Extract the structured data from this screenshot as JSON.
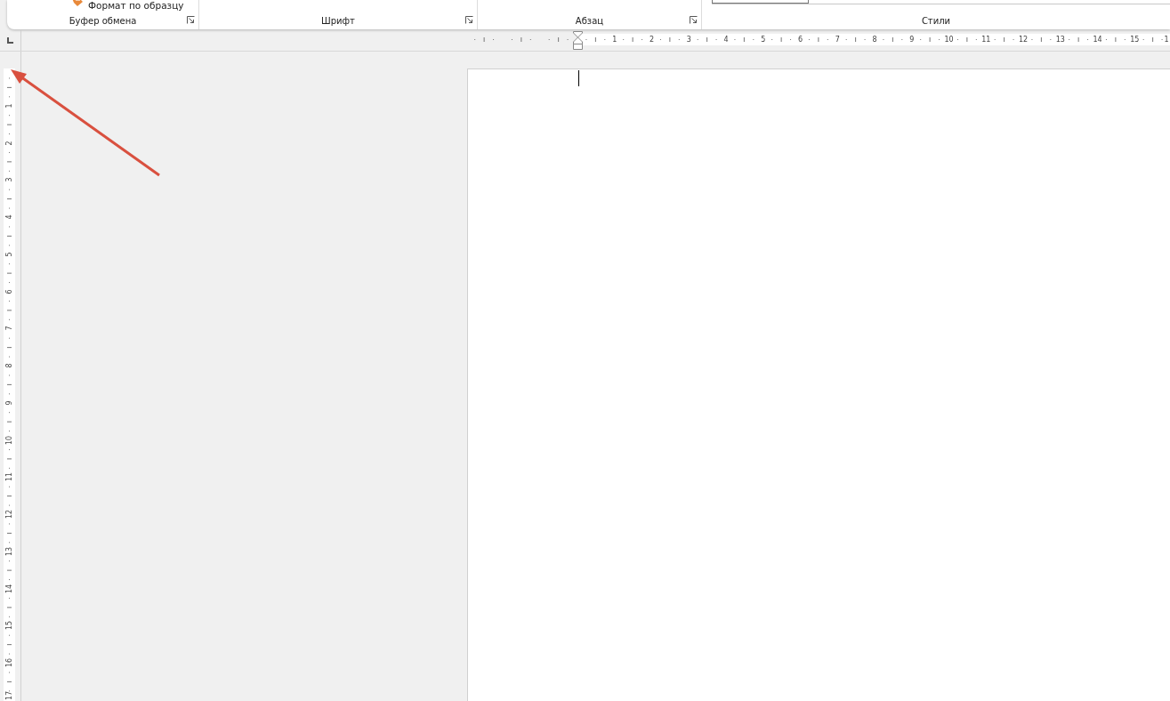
{
  "ribbon": {
    "format_painter": {
      "label": "Формат по образцу"
    },
    "groups": [
      {
        "label": "Буфер обмена",
        "launcher": true
      },
      {
        "label": "Шрифт",
        "launcher": true
      },
      {
        "label": "Абзац",
        "launcher": true
      },
      {
        "label": "Стили",
        "launcher": false
      }
    ]
  },
  "horizontal_ruler": {
    "numbers": [
      "1",
      "2",
      "3",
      "4",
      "5",
      "6",
      "7",
      "8",
      "9",
      "10",
      "11",
      "12",
      "13",
      "14",
      "15",
      "1"
    ]
  },
  "vertical_ruler": {
    "numbers": [
      "1",
      "2",
      "3",
      "4",
      "5",
      "6",
      "7",
      "8",
      "9",
      "10",
      "11",
      "12",
      "13",
      "14",
      "15",
      "16",
      "17"
    ]
  }
}
